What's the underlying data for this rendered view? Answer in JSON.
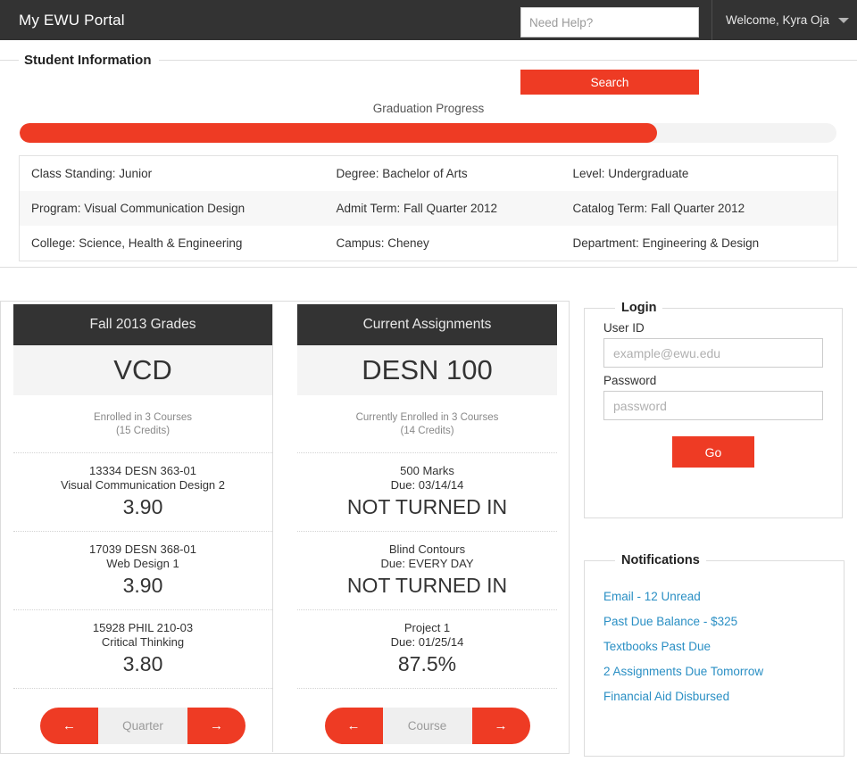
{
  "header": {
    "brand": "My EWU Portal",
    "help_placeholder": "Need Help?",
    "help_value": "",
    "user_greeting": "Welcome, Kyra Oja",
    "caret_icon": "chevron-down-icon"
  },
  "student_info": {
    "legend": "Student Information",
    "search_label": "Search",
    "progress_label": "Graduation Progress",
    "progress_percent": 78,
    "rows": [
      [
        "Class Standing: Junior",
        "Degree: Bachelor of Arts",
        "Level: Undergraduate"
      ],
      [
        "Program: Visual Communication Design",
        "Admit Term: Fall Quarter 2012",
        "Catalog Term: Fall Quarter 2012"
      ],
      [
        "College: Science, Health & Engineering",
        "Campus: Cheney",
        "Department: Engineering & Design"
      ]
    ]
  },
  "grades_card": {
    "title": "Fall 2013 Grades",
    "subject": "VCD",
    "meta_line1": "Enrolled in 3 Courses",
    "meta_line2": "(15 Credits)",
    "rows": [
      {
        "title": "13334 DESN 363-01",
        "sub": "Visual Communication Design 2",
        "value": "3.90"
      },
      {
        "title": "17039 DESN 368-01",
        "sub": "Web Design 1",
        "value": "3.90"
      },
      {
        "title": "15928 PHIL 210-03",
        "sub": "Critical Thinking",
        "value": "3.80"
      }
    ],
    "pager": {
      "prev_icon": "arrow-left-icon",
      "prev_label": "←",
      "label": "Quarter",
      "next_icon": "arrow-right-icon",
      "next_label": "→"
    }
  },
  "assignments_card": {
    "title": "Current Assignments",
    "subject": "DESN 100",
    "meta_line1": "Currently Enrolled in 3 Courses",
    "meta_line2": "(14 Credits)",
    "rows": [
      {
        "title": "500 Marks",
        "sub": "Due: 03/14/14",
        "value": "NOT TURNED IN"
      },
      {
        "title": "Blind Contours",
        "sub": "Due: EVERY DAY",
        "value": "NOT TURNED IN"
      },
      {
        "title": "Project 1",
        "sub": "Due: 01/25/14",
        "value": "87.5%"
      }
    ],
    "pager": {
      "prev_icon": "arrow-left-icon",
      "prev_label": "←",
      "label": "Course",
      "next_icon": "arrow-right-icon",
      "next_label": "→"
    }
  },
  "login": {
    "legend": "Login",
    "userid_label": "User ID",
    "userid_placeholder": "example@ewu.edu",
    "userid_value": "",
    "password_label": "Password",
    "password_placeholder": "password",
    "password_value": "",
    "go_label": "Go"
  },
  "notifications": {
    "legend": "Notifications",
    "items": [
      "Email - 12 Unread",
      "Past Due Balance - $325",
      "Textbooks Past Due",
      "2 Assignments Due Tomorrow",
      "Financial Aid Disbursed"
    ]
  },
  "colors": {
    "accent": "#EE3B24",
    "dark": "#333333",
    "link": "#2A8FC4"
  }
}
